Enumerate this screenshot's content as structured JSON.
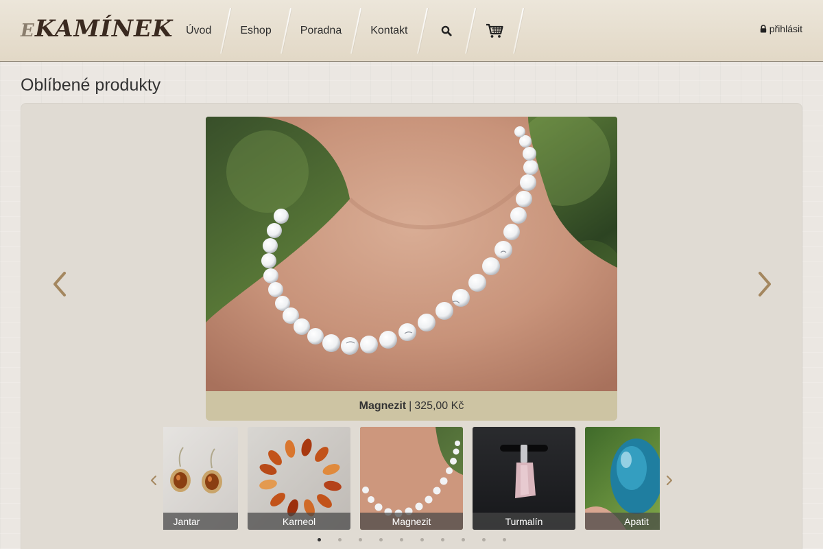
{
  "header": {
    "logo_prefix": "E",
    "logo_main": "KAMÍNEK",
    "nav": [
      {
        "label": "Úvod"
      },
      {
        "label": "Eshop"
      },
      {
        "label": "Poradna"
      },
      {
        "label": "Kontakt"
      }
    ],
    "search_icon": "search-icon",
    "cart_icon": "cart-icon",
    "login_label": "přihlásit",
    "login_icon": "lock-icon"
  },
  "page_title": "Oblíbené produkty",
  "slider": {
    "current_name": "Magnezit",
    "current_separator": "|",
    "current_price": "325,00 Kč",
    "prev_icon": "chevron-left-icon",
    "next_icon": "chevron-right-icon"
  },
  "thumbnails": [
    {
      "label": "Jantar"
    },
    {
      "label": "Karneol"
    },
    {
      "label": "Magnezit"
    },
    {
      "label": "Turmalín"
    },
    {
      "label": "Apatit"
    }
  ],
  "dots": {
    "count": 10,
    "active_index": 0
  },
  "colors": {
    "caption_bg": "#cdc4a3",
    "arrow": "#a4875f",
    "header_bg": "#e6decf"
  }
}
